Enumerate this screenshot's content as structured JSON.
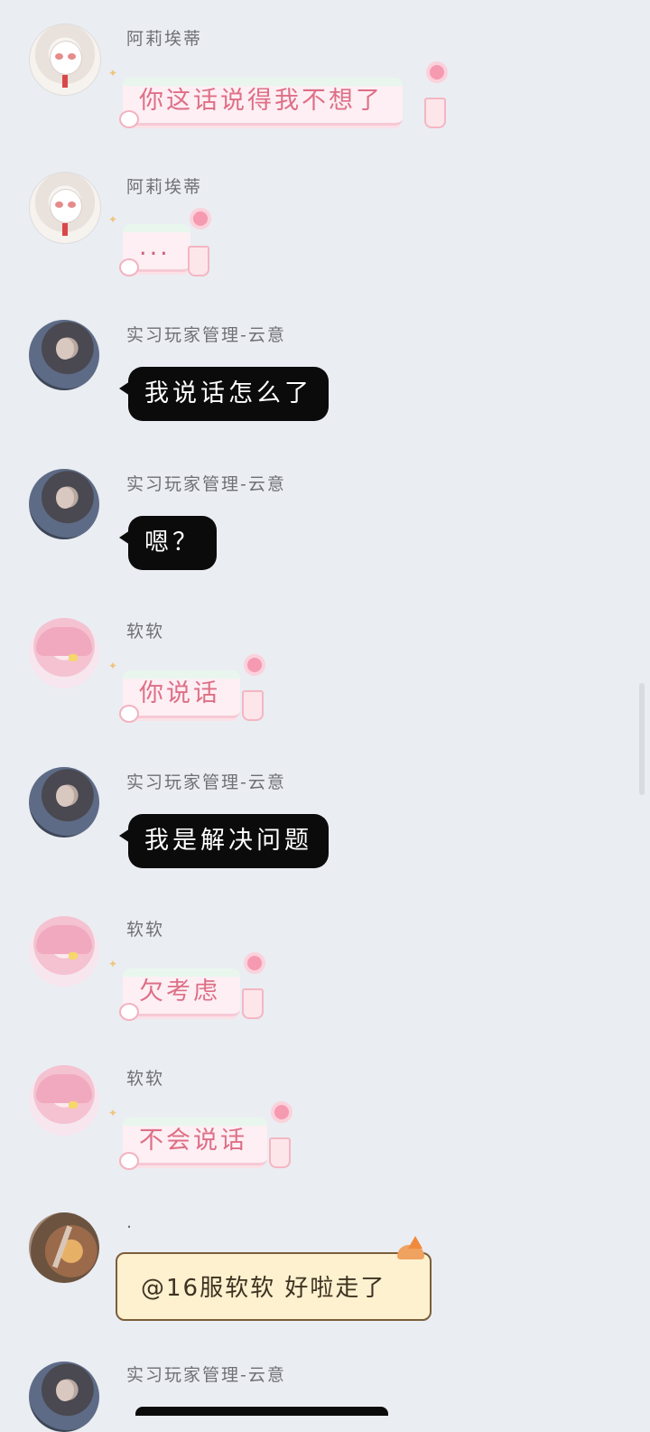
{
  "messages": [
    {
      "sender": "阿莉埃蒂",
      "text": "你这话说得我不想了"
    },
    {
      "sender": "阿莉埃蒂",
      "text": "..."
    },
    {
      "sender": "实习玩家管理-云意",
      "text": "我说话怎么了"
    },
    {
      "sender": "实习玩家管理-云意",
      "text": "嗯？"
    },
    {
      "sender": "软软",
      "text": "你说话"
    },
    {
      "sender": "实习玩家管理-云意",
      "text": "我是解决问题"
    },
    {
      "sender": "软软",
      "text": "欠考虑"
    },
    {
      "sender": "软软",
      "text": "不会说话"
    },
    {
      "sender": ".",
      "text": "@16服软软 好啦走了"
    },
    {
      "sender": "实习玩家管理-云意",
      "text": ""
    }
  ]
}
